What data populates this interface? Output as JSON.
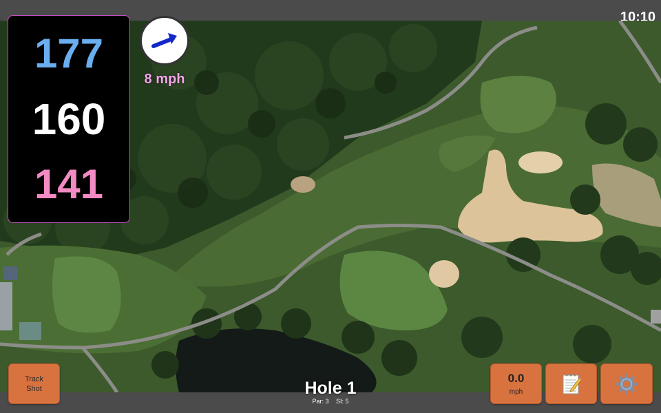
{
  "status_bar": {
    "time": "10:10"
  },
  "distances": {
    "back": "177",
    "middle": "160",
    "front": "141"
  },
  "wind": {
    "speed_text": "8 mph",
    "direction_icon": "arrow-right-icon"
  },
  "hole": {
    "title": "Hole 1",
    "par": "Par: 3",
    "stroke_index": "SI: 5"
  },
  "buttons": {
    "track_shot": {
      "line1": "Track",
      "line2": "Shot"
    },
    "wind_entry": {
      "value": "0.0",
      "unit": "mph"
    },
    "notes": {
      "icon": "notepad-icon"
    },
    "settings": {
      "icon": "gear-icon"
    }
  },
  "colors": {
    "back_distance": "#6aaef0",
    "middle_distance": "#ffffff",
    "front_distance": "#f28ac4",
    "button": "#d8723f",
    "wind_text": "#f5a6ea"
  }
}
